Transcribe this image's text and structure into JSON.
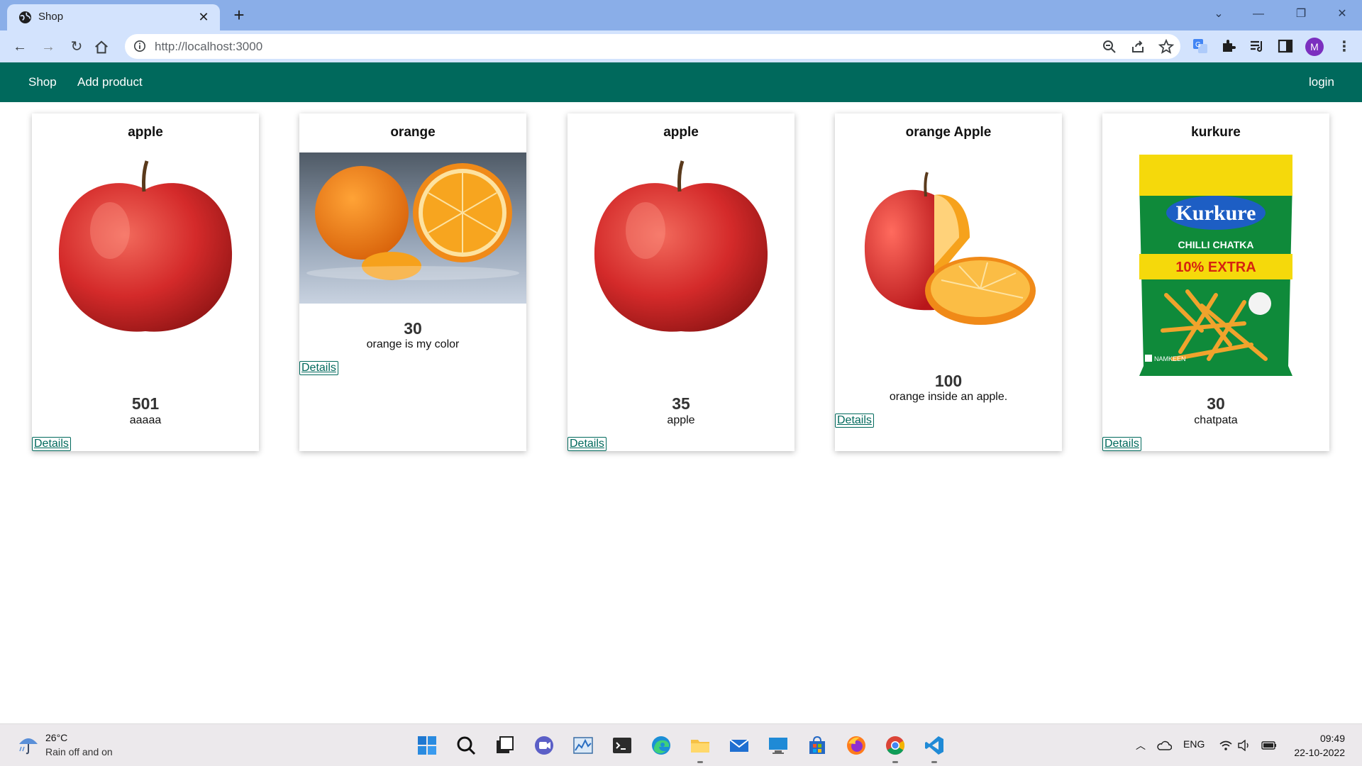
{
  "browser": {
    "tab_title": "Shop",
    "url": "http://localhost:3000",
    "profile_initial": "M"
  },
  "nav": {
    "shop": "Shop",
    "add_product": "Add product",
    "login": "login"
  },
  "products": [
    {
      "title": "apple",
      "price": "501",
      "description": "aaaaa",
      "button": "Details",
      "image": "apple"
    },
    {
      "title": "orange",
      "price": "30",
      "description": "orange is my color",
      "button": "Details",
      "image": "orange"
    },
    {
      "title": "apple",
      "price": "35",
      "description": "apple",
      "button": "Details",
      "image": "apple"
    },
    {
      "title": "orange Apple",
      "price": "100",
      "description": "orange inside an apple.",
      "button": "Details",
      "image": "orange-apple"
    },
    {
      "title": "kurkure",
      "price": "30",
      "description": "chatpata",
      "button": "Details",
      "image": "kurkure-pack"
    }
  ],
  "kurkure_pack": {
    "brand": "Kurkure",
    "flavor": "CHILLI CHATKA",
    "offer": "10% EXTRA",
    "tag": "NAMKEEN"
  },
  "taskbar": {
    "temperature": "26°C",
    "condition": "Rain off and on",
    "language": "ENG",
    "time": "09:49",
    "date": "22-10-2022"
  },
  "colors": {
    "nav_bg": "#00695c",
    "tab_strip": "#8aaee8",
    "toolbar": "#d3e3fd"
  }
}
